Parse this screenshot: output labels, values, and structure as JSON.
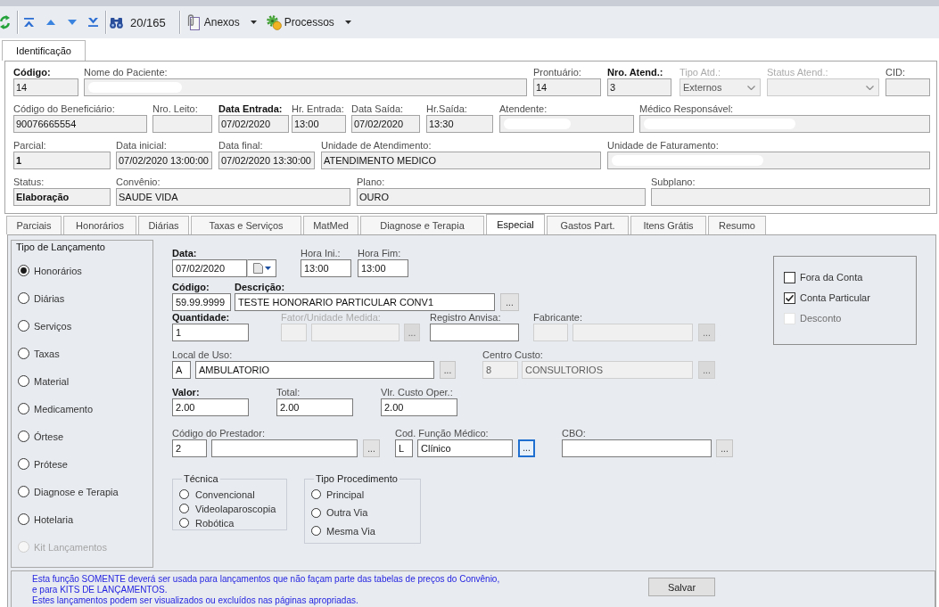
{
  "toolbar": {
    "record_counter": "20/165",
    "menus": [
      {
        "label": "Anexos",
        "kind": "attachments"
      },
      {
        "label": "Processos",
        "kind": "processes"
      }
    ]
  },
  "top_tabs": [
    {
      "label": "Identificação",
      "selected": true
    }
  ],
  "identification": {
    "rows": [
      [
        {
          "label": "Código:",
          "kind": "text",
          "value": "14",
          "bold_label": true,
          "bold_value": false,
          "disabled": false,
          "redacted": false
        },
        {
          "label": "Nome do Paciente:",
          "kind": "text",
          "bold_label": false,
          "disabled": false,
          "redacted": true
        },
        {
          "label": "Prontuário:",
          "kind": "text",
          "value": "14",
          "bold_label": false,
          "bold_value": false,
          "disabled": false,
          "redacted": false
        },
        {
          "label": "Nro. Atend.:",
          "kind": "text",
          "value": "3",
          "bold_label": true,
          "bold_value": false,
          "disabled": false,
          "redacted": false
        },
        {
          "label": "Tipo Atd.:",
          "kind": "combo",
          "value": "Externos",
          "bold_label": false,
          "bold_value": false,
          "disabled": true,
          "redacted": false
        },
        {
          "label": "Status Atend.:",
          "kind": "combo",
          "bold_label": false,
          "disabled": true,
          "redacted": false
        },
        {
          "label": "CID:",
          "kind": "text",
          "bold_label": false,
          "disabled": false,
          "redacted": false
        }
      ],
      [
        {
          "label": "Código do Beneficiário:",
          "kind": "text",
          "value": "90076665554",
          "bold_label": false,
          "bold_value": false,
          "disabled": false,
          "redacted": false
        },
        {
          "label": "Nro. Leito:",
          "kind": "text",
          "bold_label": false,
          "disabled": false,
          "redacted": false
        },
        {
          "label": "Data Entrada:",
          "kind": "text",
          "value": "07/02/2020",
          "bold_label": true,
          "bold_value": false,
          "disabled": false,
          "redacted": false
        },
        {
          "label": "Hr. Entrada:",
          "kind": "text",
          "value": "13:00",
          "bold_label": false,
          "bold_value": false,
          "disabled": false,
          "redacted": false
        },
        {
          "label": "Data Saída:",
          "kind": "text",
          "value": "07/02/2020",
          "bold_label": false,
          "bold_value": false,
          "disabled": false,
          "redacted": false
        },
        {
          "label": "Hr.Saída:",
          "kind": "text",
          "value": "13:30",
          "bold_label": false,
          "bold_value": false,
          "disabled": false,
          "redacted": false
        },
        {
          "label": "Atendente:",
          "kind": "text",
          "bold_label": false,
          "disabled": false,
          "redacted": true
        },
        {
          "label": "Médico Responsável:",
          "kind": "text",
          "bold_label": false,
          "disabled": false,
          "redacted": true
        }
      ],
      [
        {
          "label": "Parcial:",
          "kind": "text",
          "value": "1",
          "bold_label": false,
          "bold_value": true,
          "disabled": false,
          "redacted": false
        },
        {
          "label": "Data inicial:",
          "kind": "text",
          "value": "07/02/2020 13:00:00",
          "bold_label": false,
          "bold_value": false,
          "disabled": false,
          "redacted": false
        },
        {
          "label": "Data final:",
          "kind": "text",
          "value": "07/02/2020 13:30:00",
          "bold_label": false,
          "bold_value": false,
          "disabled": false,
          "redacted": false
        },
        {
          "label": "Unidade de Atendimento:",
          "kind": "text",
          "value": "ATENDIMENTO MEDICO",
          "bold_label": false,
          "bold_value": false,
          "disabled": false,
          "redacted": false
        },
        {
          "label": "Unidade de Faturamento:",
          "kind": "text",
          "bold_label": false,
          "disabled": false,
          "redacted": true
        }
      ],
      [
        {
          "label": "Status:",
          "kind": "text",
          "value": "Elaboração",
          "bold_label": false,
          "bold_value": true,
          "disabled": false,
          "redacted": false
        },
        {
          "label": "Convênio:",
          "kind": "text",
          "value": "SAUDE VIDA",
          "bold_label": false,
          "bold_value": false,
          "disabled": false,
          "redacted": false
        },
        {
          "label": "Plano:",
          "kind": "text",
          "value": "OURO",
          "bold_label": false,
          "bold_value": false,
          "disabled": false,
          "redacted": false
        },
        {
          "label": "Subplano:",
          "kind": "text",
          "bold_label": false,
          "disabled": false,
          "redacted": false
        }
      ]
    ]
  },
  "content_tabs": [
    {
      "label": "Parciais",
      "selected": false
    },
    {
      "label": "Honorários",
      "selected": false
    },
    {
      "label": "Diárias",
      "selected": false
    },
    {
      "label": "Taxas e Serviços",
      "selected": false
    },
    {
      "label": "MatMed",
      "selected": false
    },
    {
      "label": "Diagnose e Terapia",
      "selected": false
    },
    {
      "label": "Especial",
      "selected": true
    },
    {
      "label": "Gastos Part.",
      "selected": false
    },
    {
      "label": "Itens Grátis",
      "selected": false
    },
    {
      "label": "Resumo",
      "selected": false
    }
  ],
  "launch_type": {
    "title": "Tipo de Lançamento",
    "options": [
      {
        "label": "Honorários",
        "selected": true,
        "disabled": false
      },
      {
        "label": "Diárias",
        "selected": false,
        "disabled": false
      },
      {
        "label": "Serviços",
        "selected": false,
        "disabled": false
      },
      {
        "label": "Taxas",
        "selected": false,
        "disabled": false
      },
      {
        "label": "Material",
        "selected": false,
        "disabled": false
      },
      {
        "label": "Medicamento",
        "selected": false,
        "disabled": false
      },
      {
        "label": "Órtese",
        "selected": false,
        "disabled": false
      },
      {
        "label": "Prótese",
        "selected": false,
        "disabled": false
      },
      {
        "label": "Diagnose e Terapia",
        "selected": false,
        "disabled": false
      },
      {
        "label": "Hotelaria",
        "selected": false,
        "disabled": false
      },
      {
        "label": "Kit Lançamentos",
        "selected": false,
        "disabled": true
      }
    ]
  },
  "entry_form": {
    "fields": [
      {
        "label": "Data:",
        "kind": "date",
        "value": "07/02/2020",
        "bold_label": true,
        "disabled": false,
        "read_only": false
      },
      {
        "label": "Hora Ini.:",
        "kind": "text",
        "value": "13:00",
        "bold_label": false,
        "disabled": false,
        "read_only": false
      },
      {
        "label": "Hora Fim:",
        "kind": "text",
        "value": "13:00",
        "bold_label": false,
        "disabled": false,
        "read_only": false
      },
      {
        "label": "Código:",
        "kind": "text",
        "value": "59.99.9999",
        "bold_label": true,
        "disabled": false,
        "read_only": false
      },
      {
        "label": "Descrição:",
        "kind": "picker",
        "value": "TESTE HONORARIO PARTICULAR CONV1",
        "button": "...",
        "focused": false,
        "bold_label": true,
        "disabled": false,
        "read_only": false
      },
      {
        "label": "Quantidade:",
        "kind": "text",
        "value": "1",
        "bold_label": true,
        "disabled": false,
        "read_only": false
      },
      {
        "label": "Fator/Unidade Medida:",
        "kind": "lookup",
        "button": "...",
        "focused": false,
        "bold_label": false,
        "disabled": true,
        "read_only": true
      },
      {
        "label": "Registro Anvisa:",
        "kind": "text",
        "bold_label": false,
        "disabled": false,
        "read_only": false
      },
      {
        "label": "Fabricante:",
        "kind": "lookup",
        "button": "...",
        "focused": false,
        "bold_label": false,
        "disabled": false,
        "read_only": true
      },
      {
        "label": "Local de Uso:",
        "kind": "lookup",
        "code": "A",
        "value": "AMBULATORIO",
        "button": "...",
        "focused": false,
        "bold_label": false,
        "disabled": false,
        "read_only": false
      },
      {
        "label": "Centro Custo:",
        "kind": "lookup",
        "code": "8",
        "value": "CONSULTORIOS",
        "button": "...",
        "focused": false,
        "bold_label": false,
        "disabled": false,
        "read_only": true
      },
      {
        "label": "Valor:",
        "kind": "text",
        "value": "2.00",
        "bold_label": true,
        "disabled": false,
        "read_only": false
      },
      {
        "label": "Total:",
        "kind": "text",
        "value": "2.00",
        "bold_label": false,
        "disabled": false,
        "read_only": false
      },
      {
        "label": "Vlr. Custo Oper.:",
        "kind": "text",
        "value": "2.00",
        "bold_label": false,
        "disabled": false,
        "read_only": false
      },
      {
        "label": "Código do Prestador:",
        "kind": "lookup",
        "code": "2",
        "button": "...",
        "focused": false,
        "bold_label": false,
        "disabled": false,
        "read_only": false
      },
      {
        "label": "Cod. Função Médico:",
        "kind": "lookup",
        "code": "L",
        "value": "Clínico",
        "button": "...",
        "focused": true,
        "bold_label": false,
        "disabled": false,
        "read_only": false
      },
      {
        "label": "CBO:",
        "kind": "picker",
        "button": "...",
        "focused": false,
        "bold_label": false,
        "disabled": false,
        "read_only": false
      }
    ]
  },
  "technique": {
    "title": "Técnica",
    "options": [
      {
        "label": "Convencional",
        "selected": false
      },
      {
        "label": "Videolaparoscopia",
        "selected": false
      },
      {
        "label": "Robótica",
        "selected": false
      }
    ]
  },
  "procedure_type": {
    "title": "Tipo Procedimento",
    "options": [
      {
        "label": "Principal",
        "selected": false
      },
      {
        "label": "Outra Via",
        "selected": false
      },
      {
        "label": "Mesma Via",
        "selected": false
      }
    ]
  },
  "account_options": [
    {
      "label": "Fora da Conta",
      "checked": false,
      "disabled": false
    },
    {
      "label": "Conta Particular",
      "checked": true,
      "disabled": false
    },
    {
      "label": "Desconto",
      "checked": false,
      "disabled": true
    }
  ],
  "notice": {
    "lines": [
      "Esta função SOMENTE deverá ser usada para lançamentos que não façam parte das tabelas de preços do Convênio,",
      "e para KITS DE LANÇAMENTOS.",
      "Estes lançamentos podem ser visualizados ou excluídos nas páginas apropriadas."
    ]
  },
  "save_button": {
    "label": "Salvar"
  }
}
